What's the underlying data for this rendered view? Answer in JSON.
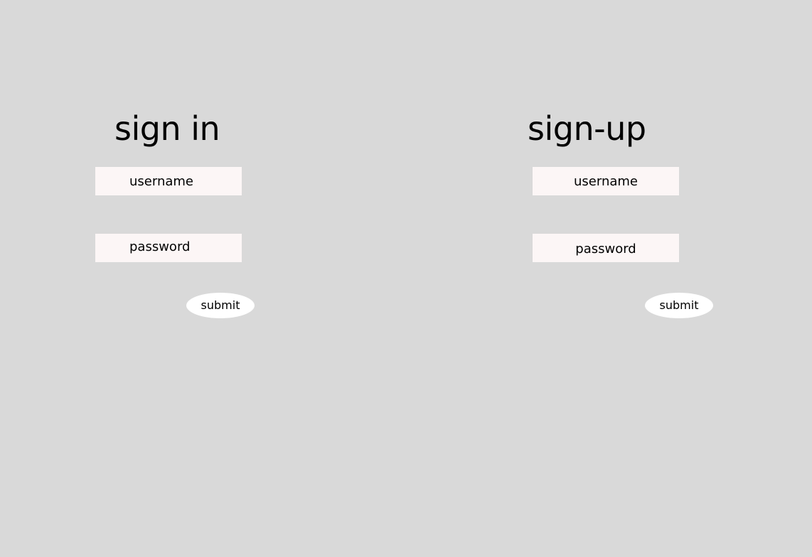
{
  "sign_in": {
    "title": "sign in",
    "username_placeholder": "username",
    "password_placeholder": "password",
    "submit_label": "submit"
  },
  "sign_up": {
    "title": "sign-up",
    "username_placeholder": "username",
    "password_placeholder": "password",
    "submit_label": "submit"
  },
  "colors": {
    "background": "#d9d9d9",
    "field_background": "#fcf6f6",
    "button_background": "#ffffff",
    "text": "#000000"
  }
}
